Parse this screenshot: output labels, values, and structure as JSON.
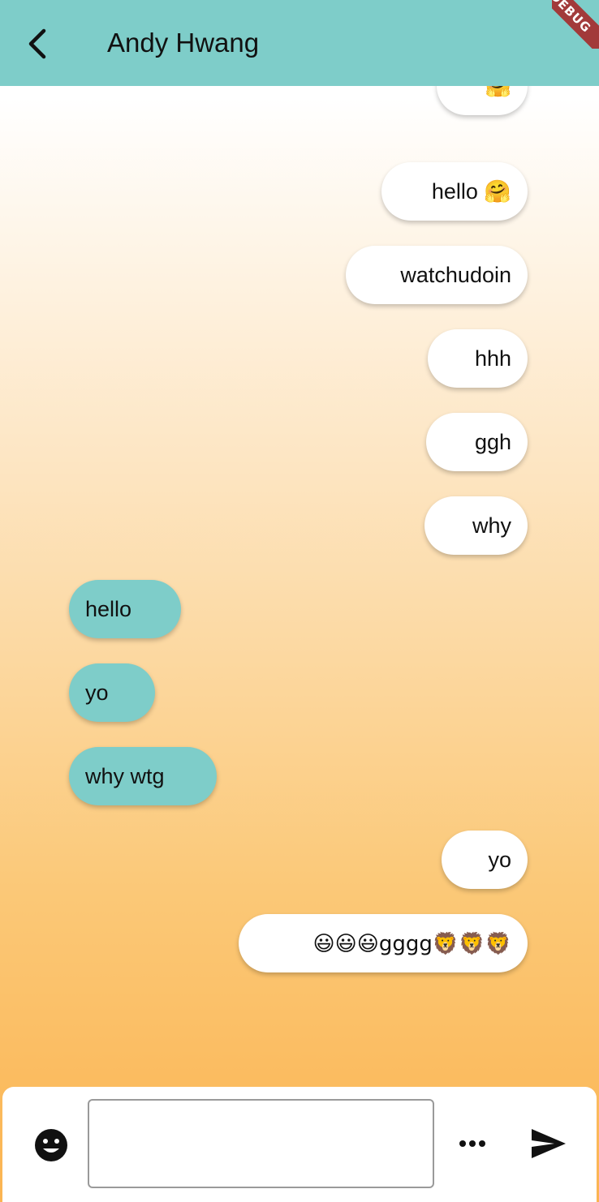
{
  "header": {
    "title": "Andy Hwang",
    "back_icon": "chevron-left-icon",
    "debug_banner": "DEBUG",
    "color": "#7ecdc9"
  },
  "messages": [
    {
      "sender": "me",
      "text": "🤗"
    },
    {
      "sender": "me",
      "text": "hello 🤗"
    },
    {
      "sender": "me",
      "text": "watchudoin"
    },
    {
      "sender": "me",
      "text": "hhh"
    },
    {
      "sender": "me",
      "text": "ggh"
    },
    {
      "sender": "me",
      "text": "why"
    },
    {
      "sender": "them",
      "text": "hello"
    },
    {
      "sender": "them",
      "text": "yo"
    },
    {
      "sender": "them",
      "text": "why wtg"
    },
    {
      "sender": "me",
      "text": "yo"
    },
    {
      "sender": "me",
      "text": "😃😃😃gggg🦁🦁🦁"
    }
  ],
  "composer": {
    "input_value": "",
    "input_placeholder": "",
    "emoji_icon": "smiley-face-icon",
    "more_icon": "more-horizontal-icon",
    "send_icon": "send-icon"
  },
  "colors": {
    "their_bubble": "#7ecdc9",
    "my_bubble": "#ffffff",
    "gradient_top": "#ffffff",
    "gradient_bottom": "#fbb451"
  }
}
